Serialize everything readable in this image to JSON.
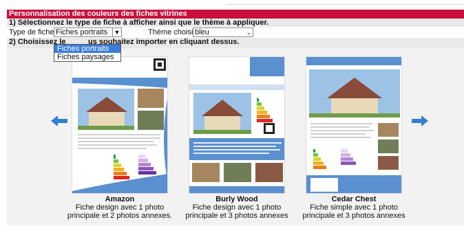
{
  "header": {
    "title": "Personnalisation des couleurs des fiches vitrines",
    "step1": "1) Sélectionnez le type de fiche à afficher ainsi que le thème à appliquer.",
    "step2_before": "2) Choisissez le",
    "step2_after": "us souhaitez importer en cliquant dessus."
  },
  "controls": {
    "type_label": "Type de fiches :",
    "type_value": "Fiches portraits",
    "theme_label": "Thème choisi :",
    "theme_value": "bleu",
    "type_options": [
      "Fiches portraits",
      "Fiches paysages"
    ]
  },
  "nav": {
    "prev_icon": "left-arrow-icon",
    "next_icon": "right-arrow-icon"
  },
  "cards": [
    {
      "name": "Amazon",
      "desc_line1": "Fiche design avec 1 photo",
      "desc_line2": "principale et 2 photos annexes."
    },
    {
      "name": "Burly Wood",
      "desc_line1": "Fiche design avec 1 photo",
      "desc_line2": "principale et 3 photos annexes"
    },
    {
      "name": "Cedar Chest",
      "desc_line1": "Fiche simple avec 1 photo",
      "desc_line2": "principale et 3 photos annexes"
    }
  ],
  "colors": {
    "title_bar": "#c8103e",
    "step_bg": "#e9e9e9",
    "dropdown_selected": "#3b7ed9",
    "theme_blue": "#5a8fd0",
    "arrow_blue": "#2f7fd4"
  }
}
